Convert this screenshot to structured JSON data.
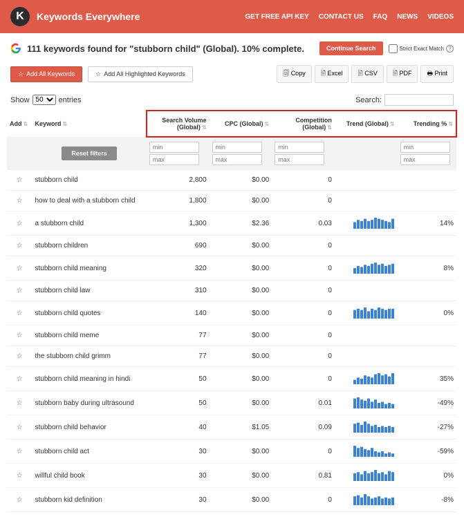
{
  "header": {
    "brand": "Keywords Everywhere",
    "nav": [
      "GET FREE API KEY",
      "CONTACT US",
      "FAQ",
      "NEWS",
      "VIDEOS"
    ]
  },
  "title": "111 keywords found for \"stubborn child\" (Global). 10% complete.",
  "continue_label": "Continue Search",
  "strict_label": "Strict Exact Match",
  "actions": {
    "add_all": "Add All Keywords",
    "add_highlighted": "Add All Highlighted Keywords",
    "exports": [
      "Copy",
      "Excel",
      "CSV",
      "PDF",
      "Print"
    ]
  },
  "entries": {
    "show": "Show",
    "count": "50",
    "suffix": "entries"
  },
  "search_label": "Search:",
  "columns": {
    "add": "Add",
    "keyword": "Keyword",
    "volume": "Search Volume (Global)",
    "cpc": "CPC (Global)",
    "competition": "Competition (Global)",
    "trend": "Trend (Global)",
    "trending": "Trending %"
  },
  "filters": {
    "reset": "Reset filters",
    "min": "min",
    "max": "max"
  },
  "rows": [
    {
      "keyword": "stubborn child",
      "volume": "2,800",
      "cpc": "$0.00",
      "comp": "0",
      "trend": null,
      "trending": ""
    },
    {
      "keyword": "how to deal with a stubborn child",
      "volume": "1,800",
      "cpc": "$0.00",
      "comp": "0",
      "trend": null,
      "trending": ""
    },
    {
      "keyword": "a stubborn child",
      "volume": "1,300",
      "cpc": "$2.36",
      "comp": "0.03",
      "trend": [
        6,
        8,
        7,
        9,
        7,
        8,
        10,
        9,
        8,
        7,
        6,
        9
      ],
      "trending": "14%"
    },
    {
      "keyword": "stubborn children",
      "volume": "690",
      "cpc": "$0.00",
      "comp": "0",
      "trend": null,
      "trending": ""
    },
    {
      "keyword": "stubborn child meaning",
      "volume": "320",
      "cpc": "$0.00",
      "comp": "0",
      "trend": [
        5,
        7,
        6,
        8,
        7,
        9,
        10,
        8,
        9,
        7,
        8,
        9
      ],
      "trending": "8%"
    },
    {
      "keyword": "stubborn child law",
      "volume": "310",
      "cpc": "$0.00",
      "comp": "0",
      "trend": null,
      "trending": ""
    },
    {
      "keyword": "stubborn child quotes",
      "volume": "140",
      "cpc": "$0.00",
      "comp": "0",
      "trend": [
        7,
        8,
        7,
        9,
        6,
        8,
        7,
        9,
        8,
        7,
        8,
        8
      ],
      "trending": "0%"
    },
    {
      "keyword": "stubborn child meme",
      "volume": "77",
      "cpc": "$0.00",
      "comp": "0",
      "trend": null,
      "trending": ""
    },
    {
      "keyword": "the stubborn child grimm",
      "volume": "77",
      "cpc": "$0.00",
      "comp": "0",
      "trend": null,
      "trending": ""
    },
    {
      "keyword": "stubborn child meaning in hindi",
      "volume": "50",
      "cpc": "$0.00",
      "comp": "0",
      "trend": [
        4,
        6,
        5,
        8,
        7,
        6,
        9,
        10,
        8,
        9,
        7,
        10
      ],
      "trending": "35%"
    },
    {
      "keyword": "stubborn baby during ultrasound",
      "volume": "50",
      "cpc": "$0.00",
      "comp": "0.01",
      "trend": [
        9,
        10,
        8,
        7,
        9,
        6,
        8,
        5,
        6,
        4,
        5,
        4
      ],
      "trending": "-49%"
    },
    {
      "keyword": "stubborn child behavior",
      "volume": "40",
      "cpc": "$1.05",
      "comp": "0.09",
      "trend": [
        8,
        9,
        7,
        10,
        8,
        6,
        7,
        5,
        6,
        5,
        6,
        5
      ],
      "trending": "-27%"
    },
    {
      "keyword": "stubborn child act",
      "volume": "30",
      "cpc": "$0.00",
      "comp": "0",
      "trend": [
        10,
        8,
        9,
        7,
        6,
        8,
        5,
        4,
        5,
        3,
        4,
        3
      ],
      "trending": "-59%"
    },
    {
      "keyword": "willful child book",
      "volume": "30",
      "cpc": "$0.00",
      "comp": "0.81",
      "trend": [
        7,
        8,
        6,
        9,
        7,
        8,
        10,
        7,
        8,
        6,
        9,
        8
      ],
      "trending": "0%"
    },
    {
      "keyword": "stubborn kid definition",
      "volume": "30",
      "cpc": "$0.00",
      "comp": "0",
      "trend": [
        8,
        9,
        7,
        10,
        8,
        6,
        7,
        8,
        6,
        7,
        6,
        7
      ],
      "trending": "-8%"
    }
  ]
}
